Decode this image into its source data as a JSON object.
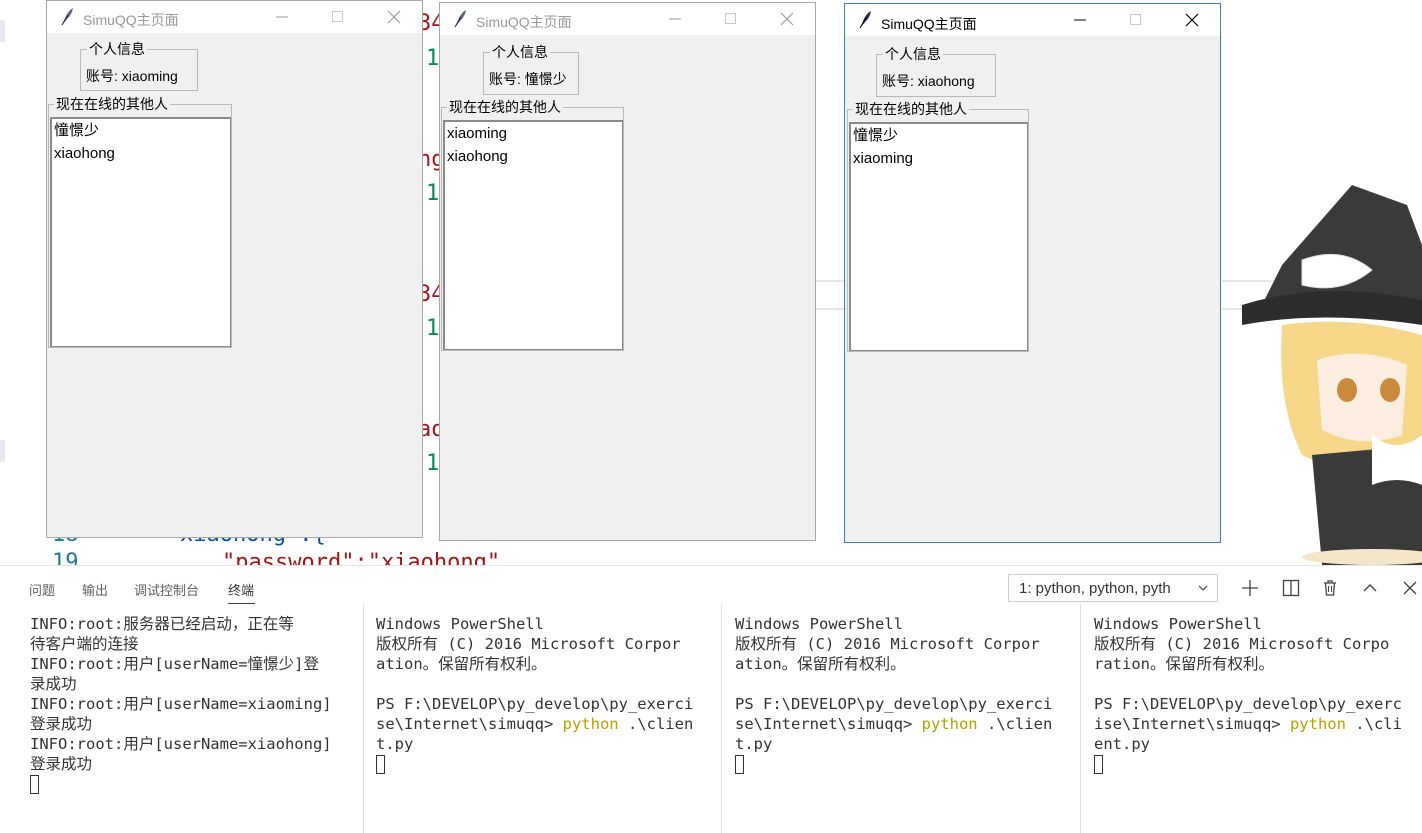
{
  "windows": [
    {
      "title": "SimuQQ主页面",
      "active": false,
      "info_legend": "个人信息",
      "account_label": "账号:",
      "account_value": "xiaoming",
      "online_legend": "现在在线的其他人",
      "online_users": [
        "憧憬少",
        "xiaohong"
      ]
    },
    {
      "title": "SimuQQ主页面",
      "active": false,
      "info_legend": "个人信息",
      "account_label": "账号:",
      "account_value": "憧憬少",
      "online_legend": "现在在线的其他人",
      "online_users": [
        "xiaoming",
        "xiaohong"
      ]
    },
    {
      "title": "SimuQQ主页面",
      "active": true,
      "info_legend": "个人信息",
      "account_label": "账号:",
      "account_value": "xiaohong",
      "online_legend": "现在在线的其他人",
      "online_users": [
        "憧憬少",
        "xiaoming"
      ]
    }
  ],
  "editor": {
    "fragments": [
      "34",
      "1",
      "ng",
      "1",
      "34",
      "1",
      "ao",
      "1",
      "xiaohong\":{",
      "\"password\":\"xiaohong\""
    ],
    "line_numbers": [
      "18",
      "19"
    ]
  },
  "panel": {
    "tabs": [
      "问题",
      "输出",
      "调试控制台",
      "终端"
    ],
    "active_tab": "终端",
    "terminal_select": "1: python, python, pyth",
    "actions": [
      "plus-icon",
      "split-icon",
      "trash-icon",
      "chevron-up-icon",
      "close-icon"
    ]
  },
  "terminals": [
    {
      "lines": [
        "INFO:root:服务器已经启动，正在等",
        "待客户端的连接",
        "INFO:root:用户[userName=憧憬少]登",
        "录成功",
        "INFO:root:用户[userName=xiaoming]",
        "登录成功",
        "INFO:root:用户[userName=xiaohong]",
        "登录成功"
      ]
    },
    {
      "lines": [
        "Windows PowerShell",
        "版权所有 (C) 2016 Microsoft Corpor",
        "ation。保留所有权利。",
        ""
      ],
      "prompt_a": "PS F:\\DEVELOP\\py_develop\\py_exerci",
      "prompt_b": "se\\Internet\\simuqq> ",
      "cmd": "python",
      "arg_a": " .\\clien",
      "arg_b": "t.py"
    },
    {
      "lines": [
        "Windows PowerShell",
        "版权所有 (C) 2016 Microsoft Corpor",
        "ation。保留所有权利。",
        ""
      ],
      "prompt_a": "PS F:\\DEVELOP\\py_develop\\py_exerci",
      "prompt_b": "se\\Internet\\simuqq> ",
      "cmd": "python",
      "arg_a": " .\\clien",
      "arg_b": "t.py"
    },
    {
      "lines": [
        "Windows PowerShell",
        "版权所有 (C) 2016 Microsoft Corpo",
        "ration。保留所有权利。",
        ""
      ],
      "prompt_a": "PS F:\\DEVELOP\\py_develop\\py_exerc",
      "prompt_b": "ise\\Internet\\simuqq> ",
      "cmd": "python",
      "arg_a": " .\\cli",
      "arg_b": "ent.py"
    }
  ],
  "colors": {
    "accent_border": "#3c7fb1",
    "string_red": "#a31515",
    "number_green": "#098658",
    "keyword_yellow": "#b8a000"
  }
}
